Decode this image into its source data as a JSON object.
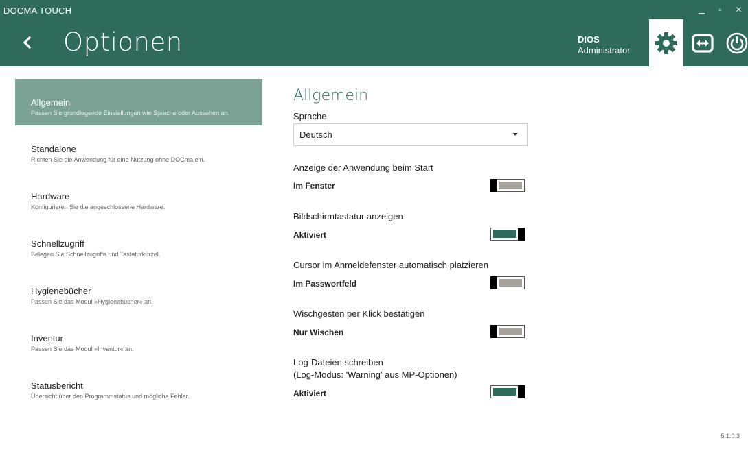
{
  "header": {
    "app_title": "DOCMA TOUCH",
    "page_title": "Optionen",
    "user_name": "DIOS",
    "user_role": "Administrator",
    "bg_color": "#2f6b5b",
    "icons": [
      "back-icon",
      "gear-icon",
      "remote-arrows-icon",
      "power-icon"
    ],
    "window_controls": [
      "minimize",
      "maximize",
      "close"
    ]
  },
  "sidebar": {
    "items": [
      {
        "title": "Allgemein",
        "desc": "Passen Sie grundlegende Einstellungen wie Sprache oder Aussehen an.",
        "active": true
      },
      {
        "title": "Standalone",
        "desc": "Richten Sie die Anwendung für eine Nutzung ohne DOCma ein."
      },
      {
        "title": "Hardware",
        "desc": "Konfigurieren Sie die angeschlossene Hardware."
      },
      {
        "title": "Schnellzugriff",
        "desc": "Belegen Sie Schnellzugriffe und Tastaturkürzel."
      },
      {
        "title": "Hygienebücher",
        "desc": "Passen Sie das Modul »Hygienebücher« an."
      },
      {
        "title": "Inventur",
        "desc": "Passen Sie das Modul »Inventur« an."
      },
      {
        "title": "Statusbericht",
        "desc": "Übersicht über den Programmstatus und mögliche Fehler."
      }
    ]
  },
  "main": {
    "section_title": "Allgemein",
    "language": {
      "label": "Sprache",
      "value": "Deutsch"
    },
    "settings": [
      {
        "label": "Anzeige der Anwendung beim Start",
        "value": "Im Fenster",
        "on": false
      },
      {
        "label": "Bildschirmtastatur anzeigen",
        "value": "Aktiviert",
        "on": true
      },
      {
        "label": "Cursor im Anmeldefenster automatisch platzieren",
        "value": "Im Passwortfeld",
        "on": false
      },
      {
        "label": "Wischgesten per Klick bestätigen",
        "value": "Nur Wischen",
        "on": false
      },
      {
        "label": "Log-Dateien schreiben",
        "label2": "(Log-Modus: 'Warning' aus MP-Optionen)",
        "value": "Aktiviert",
        "on": true
      }
    ]
  },
  "version": "5.1.0.3"
}
